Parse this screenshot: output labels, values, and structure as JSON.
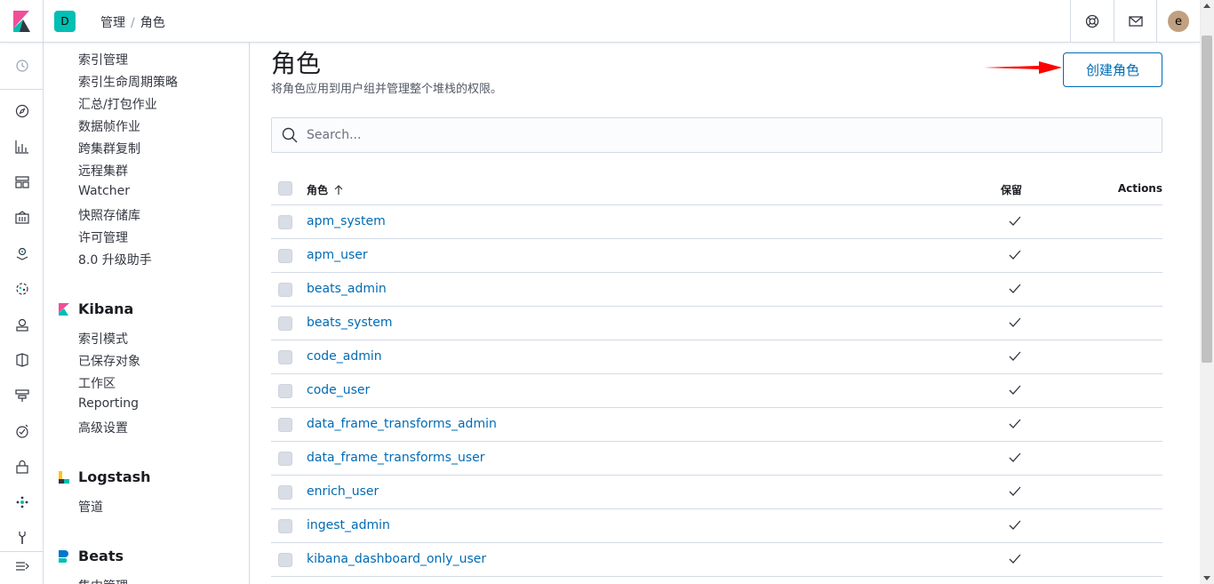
{
  "topbar": {
    "space_initial": "D",
    "breadcrumbs": [
      "管理",
      "角色"
    ],
    "avatar_initial": "e"
  },
  "sidenav": {
    "items_top": [
      "索引管理",
      "索引生命周期策略",
      "汇总/打包作业",
      "数据帧作业",
      "跨集群复制",
      "远程集群",
      "Watcher",
      "快照存储库",
      "许可管理",
      "8.0 升级助手"
    ],
    "kibana": {
      "title": "Kibana",
      "items": [
        "索引模式",
        "已保存对象",
        "工作区",
        "Reporting",
        "高级设置"
      ]
    },
    "logstash": {
      "title": "Logstash",
      "items": [
        "管道"
      ]
    },
    "beats": {
      "title": "Beats",
      "items": [
        "集中管理"
      ]
    }
  },
  "main": {
    "title": "角色",
    "description": "将角色应用到用户组并管理整个堆栈的权限。",
    "create_button": "创建角色",
    "search_placeholder": "Search...",
    "columns": {
      "role": "角色",
      "reserved": "保留",
      "actions": "Actions"
    },
    "roles": [
      "apm_system",
      "apm_user",
      "beats_admin",
      "beats_system",
      "code_admin",
      "code_user",
      "data_frame_transforms_admin",
      "data_frame_transforms_user",
      "enrich_user",
      "ingest_admin",
      "kibana_dashboard_only_user"
    ]
  },
  "colors": {
    "accent": "#006bb4",
    "space_badge": "#00bfb3",
    "arrow": "#ff0000"
  }
}
